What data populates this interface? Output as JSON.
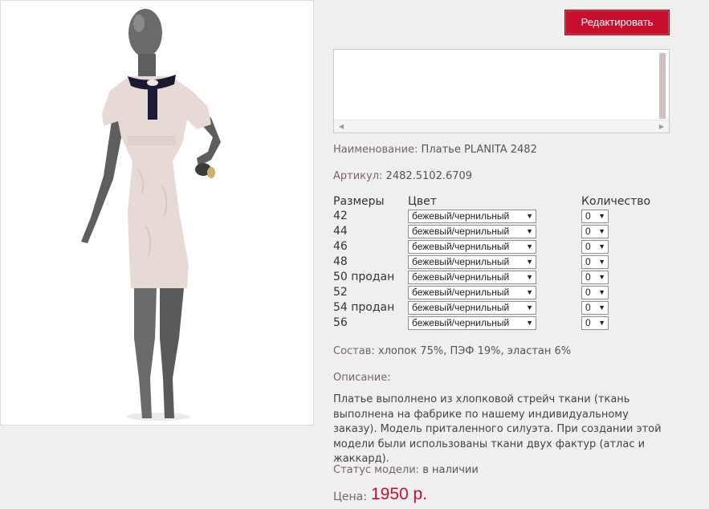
{
  "product_photo": {
    "alt": "Платье PLANITA 2482 на манекене"
  },
  "edit_button_label": "Редактировать",
  "name": {
    "label": "Наименование:",
    "value": "Платье PLANITA 2482"
  },
  "article": {
    "label": "Артикул:",
    "value": "2482.5102.6709"
  },
  "table": {
    "headers": {
      "sizes": "Размеры",
      "color": "Цвет",
      "quantity": "Количество"
    },
    "rows": [
      {
        "size": "42",
        "color": "бежевый/чернильный",
        "qty": "0"
      },
      {
        "size": "44",
        "color": "бежевый/чернильный",
        "qty": "0"
      },
      {
        "size": "46",
        "color": "бежевый/чернильный",
        "qty": "0"
      },
      {
        "size": "48",
        "color": "бежевый/чернильный",
        "qty": "0"
      },
      {
        "size": "50 продан",
        "color": "бежевый/чернильный",
        "qty": "0"
      },
      {
        "size": "52",
        "color": "бежевый/чернильный",
        "qty": "0"
      },
      {
        "size": "54 продан",
        "color": "бежевый/чернильный",
        "qty": "0"
      },
      {
        "size": "56",
        "color": "бежевый/чернильный",
        "qty": "0"
      }
    ]
  },
  "composition": {
    "label": "Состав:",
    "value": "хлопок 75%, ПЭФ 19%, эластан 6%"
  },
  "description": {
    "label": "Описание:",
    "text": "Платье выполнено из хлопковой стрейч ткани (ткань выполнена на фабрике по нашему индивидуальному заказу). Модель приталенного силуэта. При создании этой модели были использованы ткани двух фактур (атлас и жаккард)."
  },
  "status": {
    "label": "Статус модели:",
    "value": "в наличии"
  },
  "price": {
    "label": "Цена:",
    "value": "1950 р."
  },
  "colors": {
    "accent": "#c8102e",
    "label": "#7a6565",
    "background": "#efefef"
  }
}
